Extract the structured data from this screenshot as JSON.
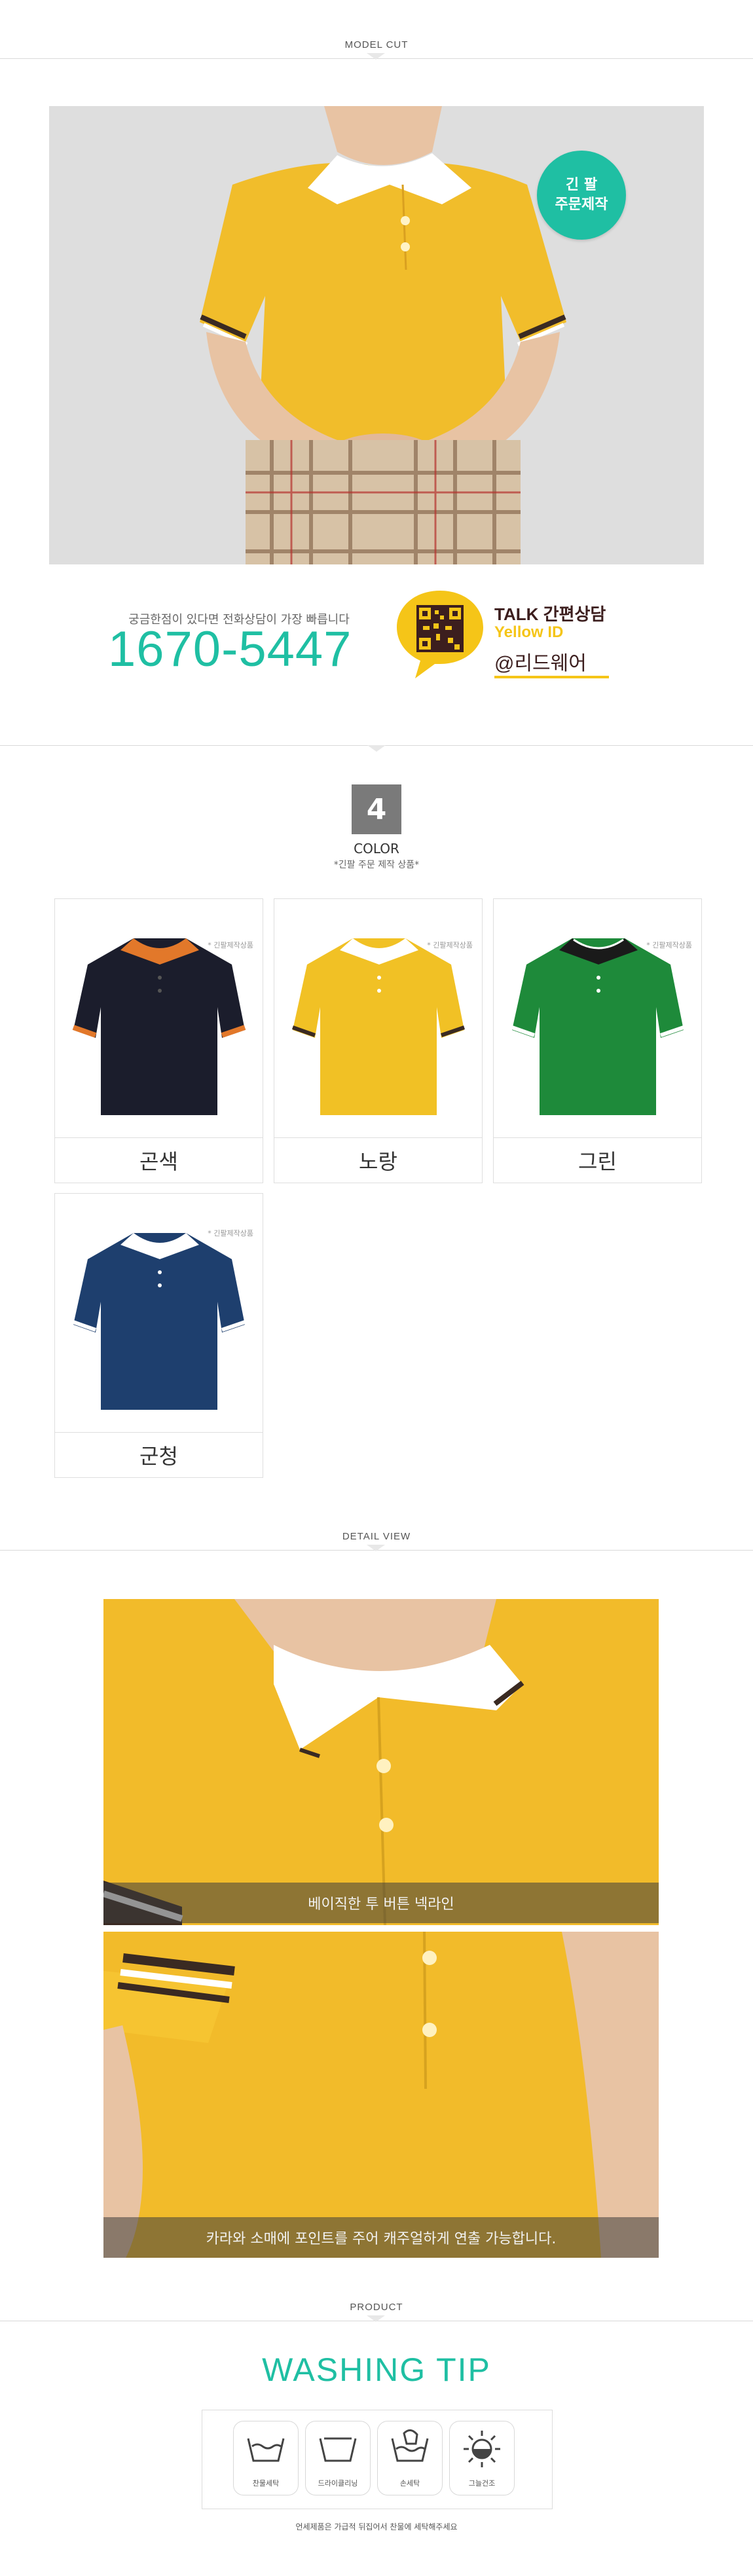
{
  "sections": {
    "model_cut": "MODEL CUT",
    "detail_view": "DETAIL VIEW",
    "product": "PRODUCT"
  },
  "badge": {
    "line1": "긴 팔",
    "line2": "주문제작"
  },
  "contact": {
    "tagline": "궁금한점이 있다면 전화상담이 가장 빠릅니다",
    "phone": "1670-5447",
    "talk_label": "TALK 간편상담",
    "yellow_id_label": "Yellow ID",
    "handle": "@리드웨어"
  },
  "color_section": {
    "count": "4",
    "title": "COLOR",
    "subtitle": "*긴팔 주문 제작 상품*",
    "card_note": "* 긴팔제작상품",
    "items": [
      {
        "name": "곤색",
        "body": "#1b1d2c",
        "collar": "#e2782a",
        "trim": "#e2782a"
      },
      {
        "name": "노랑",
        "body": "#f1c125",
        "collar": "#ffffff",
        "trim": "#3a2a22"
      },
      {
        "name": "그린",
        "body": "#1e8a3a",
        "collar": "#1a1a1a",
        "trim": "#ffffff"
      },
      {
        "name": "군청",
        "body": "#1e3f6e",
        "collar": "#ffffff",
        "trim": "#ffffff"
      }
    ]
  },
  "detail": {
    "caption1": "베이직한 투 버튼 넥라인",
    "caption2": "카라와 소매에 포인트를 주어 캐주얼하게 연출 가능합니다."
  },
  "washing": {
    "title": "WASHING TIP",
    "items": [
      {
        "icon": "hand-wash-icon",
        "label": "찬물세탁"
      },
      {
        "icon": "dry-clean-icon",
        "label": "드라이클리닝"
      },
      {
        "icon": "hand-wash-water-icon",
        "label": "손세탁"
      },
      {
        "icon": "shade-dry-icon",
        "label": "그늘건조"
      }
    ],
    "footnote": "언세제품은 가급적 뒤집어서 찬물에 세탁해주세요"
  },
  "colors": {
    "accent": "#1fbfa3",
    "kakao": "#f5c518",
    "brown": "#3c1e1e"
  }
}
